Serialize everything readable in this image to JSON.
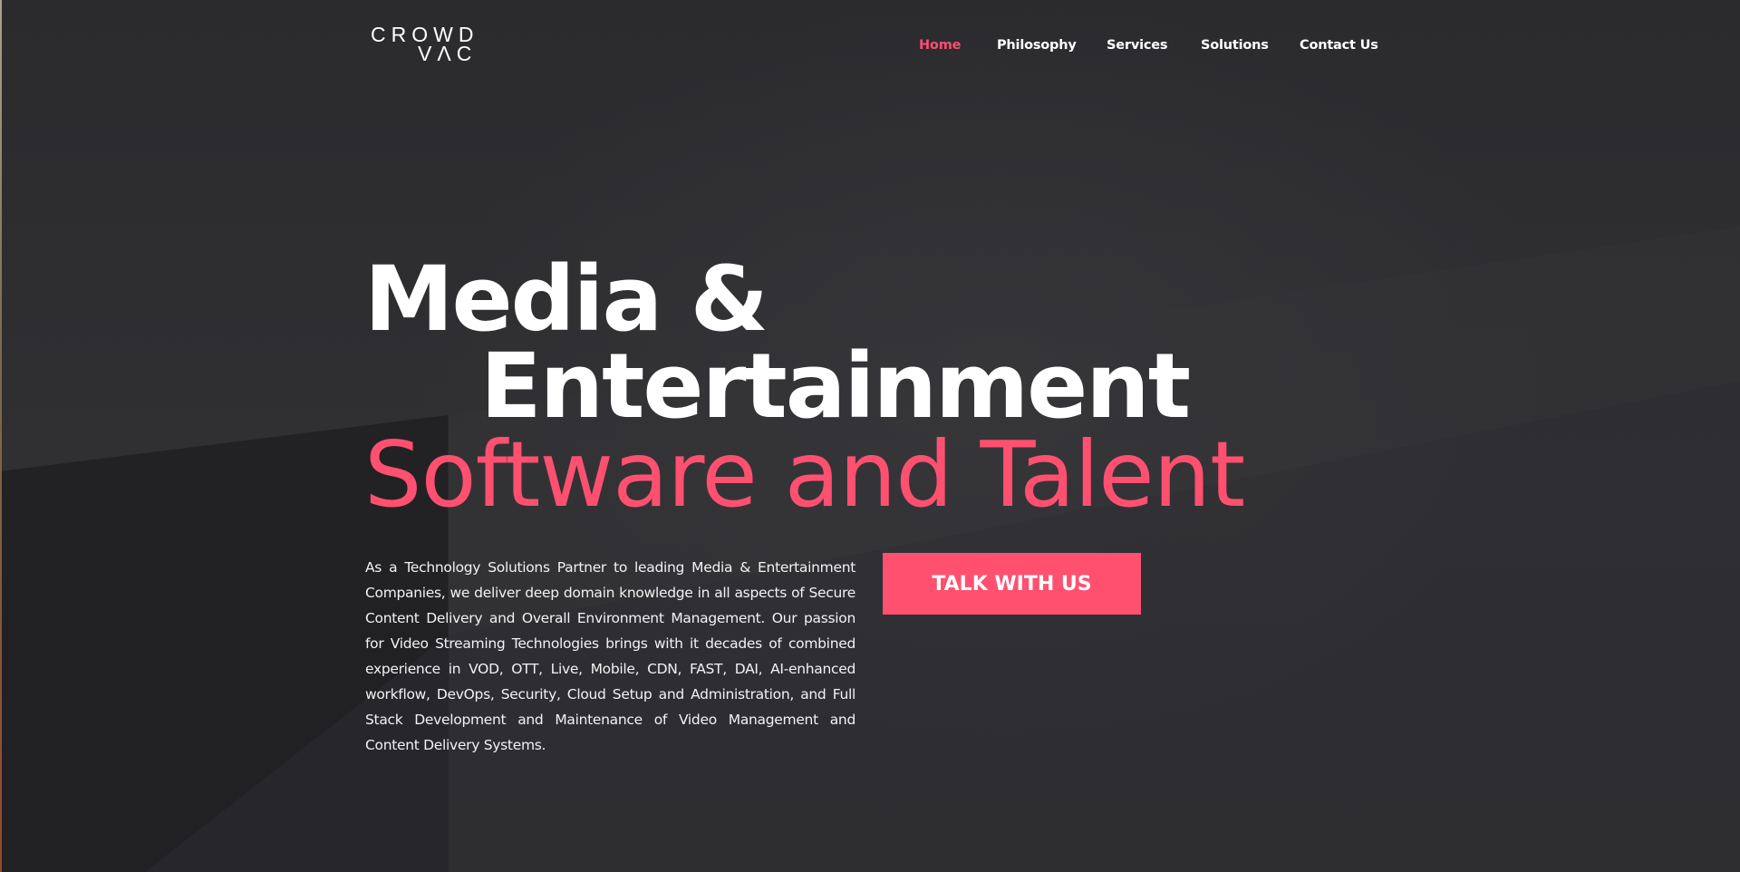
{
  "brand": {
    "logo_line1": "CROWD",
    "logo_line2": "VΛC",
    "accent_color": "#ff5070"
  },
  "nav": {
    "items": [
      {
        "label": "Home",
        "active": true
      },
      {
        "label": "Philosophy",
        "active": false
      },
      {
        "label": "Services",
        "active": false
      },
      {
        "label": "Solutions",
        "active": false
      },
      {
        "label": "Contact Us",
        "active": false
      }
    ]
  },
  "hero": {
    "title_line1": "Media &",
    "title_line2": "Entertainment",
    "title_line3": "Software and Talent",
    "description": "As a Technology Solutions Partner to leading Media & Entertainment Companies, we deliver deep domain knowledge in all aspects of Secure Content Delivery and Overall Environment Management. Our passion for Video Streaming Technologies brings with it decades of combined experience in VOD, OTT, Live, Mobile, CDN, FAST, DAI, AI-enhanced workflow, DevOps, Security, Cloud Setup and Administration, and Full Stack Development and Maintenance of Video Management and Content Delivery Systems.",
    "cta_label": "TALK WITH US"
  }
}
